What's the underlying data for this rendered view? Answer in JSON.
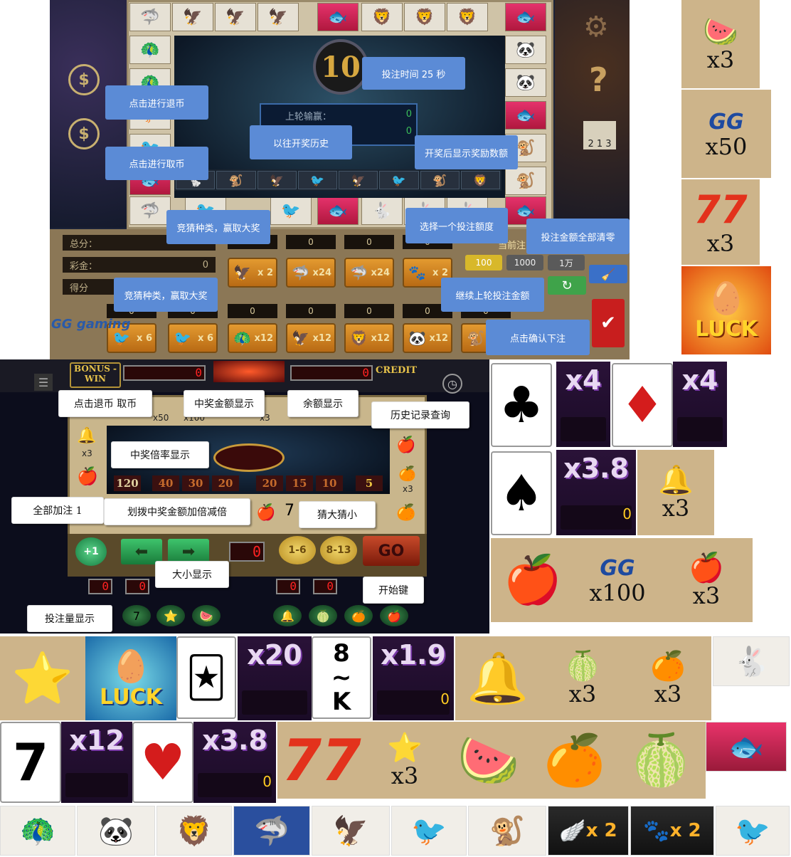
{
  "top_game": {
    "timer": "10",
    "result_label": "上轮输赢：",
    "result_values": [
      "0",
      "0"
    ],
    "info_rows": [
      {
        "label": "总分：",
        "value": ""
      },
      {
        "label": "彩金：",
        "value": "0"
      },
      {
        "label": "得分",
        "value": ""
      }
    ],
    "bet_row1": [
      {
        "icon": "🦅",
        "mult": "x 2",
        "count": ""
      },
      {
        "icon": "🦈",
        "mult": "x24",
        "count": "0"
      },
      {
        "icon": "🦈",
        "mult": "x24",
        "count": "0"
      },
      {
        "icon": "🐾",
        "mult": "x 2",
        "count": "0"
      }
    ],
    "bet_row2": [
      {
        "icon": "🐦",
        "mult": "x 6",
        "count": "0"
      },
      {
        "icon": "🐦",
        "mult": "x 6",
        "count": "0"
      },
      {
        "icon": "🦚",
        "mult": "x12",
        "count": "0"
      },
      {
        "icon": "🦅",
        "mult": "x12",
        "count": "0"
      },
      {
        "icon": "🦁",
        "mult": "x12",
        "count": "0"
      },
      {
        "icon": "🐼",
        "mult": "x12",
        "count": "0"
      },
      {
        "icon": "🐒",
        "mult": "x12",
        "count": "0"
      }
    ],
    "amounts": [
      "100",
      "1000",
      "1万"
    ],
    "current_bet_label": "当前注",
    "brand": "GG gaming"
  },
  "top_tooltips": {
    "bet_time": "投注时间 25 秒",
    "cash_out": "点击进行退币",
    "history": "以往开奖历史",
    "reward_display": "开奖后显示奖励数额",
    "cash_in": "点击进行取币",
    "guess_type_1": "竞猜种类，赢取大奖",
    "choose_amount": "选择一个投注额度",
    "clear_all": "投注金额全部清零",
    "guess_type_2": "竞猜种类，赢取大奖",
    "continue_last": "继续上轮投注金额",
    "confirm": "点击确认下注"
  },
  "mid_game": {
    "bonus_label": "BONUS -WIN",
    "bonus_value": "0",
    "credit_value": "0",
    "credit_label": "CREDIT",
    "top_mults": [
      "x50",
      "x100",
      "x3"
    ],
    "multipliers": [
      "120",
      "40",
      "30",
      "20",
      "20",
      "15",
      "10",
      "5"
    ],
    "side_mults": [
      "x3",
      "x3"
    ],
    "bet_lcd": "0",
    "big_small_lcd": "0",
    "guess_buttons": [
      "1-6",
      "8-13",
      "GO"
    ],
    "add_all": "+1"
  },
  "mid_tooltips": {
    "cash_in_out": "点击退币  取币",
    "win_amount": "中奖金额显示",
    "balance": "余额显示",
    "history_query": "历史记录查询",
    "win_rate": "中奖倍率显示",
    "add_all": "全部加注 1",
    "double_half": "划拨中奖金额加倍减倍",
    "guess": "猜大猜小",
    "big_small": "大小显示",
    "start": "开始键",
    "bet_amount": "投注量显示"
  },
  "sprites": {
    "watermelon_mult": "x3",
    "gg_mult": "x50",
    "seven_mult": "x3",
    "luck_text": "LUCK",
    "club_mult": "x4",
    "diamond_mult": "x4",
    "spade_mult": "x3.8",
    "spade_zero": "0",
    "bell_mult": "x3",
    "gg_mult2": "x100",
    "apple_mult": "x3",
    "joker_mult": "x20",
    "eight_k_mult": "x1.9",
    "eight_k_top": "8",
    "eight_k_mid": "~",
    "eight_k_bot": "K",
    "eight_k_zero": "0",
    "lime_mult": "x3",
    "orange_mult": "x3",
    "seven_card": "7",
    "seven_card_mult": "x12",
    "heart_mult": "x3.8",
    "heart_zero": "0",
    "star_mult": "x3",
    "bottom_x2_a": "x 2",
    "bottom_x2_b": "x 2"
  }
}
